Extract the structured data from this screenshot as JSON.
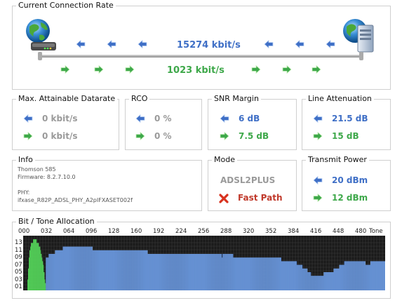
{
  "connection": {
    "title": "Current Connection Rate",
    "downstream": "15274 kbit/s",
    "upstream": "1023 kbit/s"
  },
  "max_rate": {
    "title": "Max. Attainable Datarate",
    "down": "0 kbit/s",
    "up": "0 kbit/s"
  },
  "rco": {
    "title": "RCO",
    "down": "0 %",
    "up": "0 %"
  },
  "snr": {
    "title": "SNR Margin",
    "down": "6 dB",
    "up": "7.5 dB"
  },
  "attenuation": {
    "title": "Line Attenuation",
    "down": "21.5 dB",
    "up": "15 dB"
  },
  "info": {
    "title": "Info",
    "model": "Thomson 585",
    "firmware": "Firmware: 8.2.7.10.0",
    "phy_label": "PHY:",
    "phy_value": "ifxase_R82P_ADSL_PHY_A2pIFXASET002f"
  },
  "mode": {
    "title": "Mode",
    "standard": "ADSL2PLUS",
    "path": "Fast Path"
  },
  "power": {
    "title": "Transmit Power",
    "down": "20 dBm",
    "up": "12 dBm"
  },
  "bits": {
    "title": "Bit / Tone Allocation",
    "x_ticks": [
      "000",
      "032",
      "064",
      "096",
      "128",
      "160",
      "192",
      "224",
      "256",
      "288",
      "320",
      "352",
      "384",
      "416",
      "448",
      "480",
      "Tone"
    ],
    "y_ticks": [
      "13",
      "11",
      "09",
      "07",
      "05",
      "03",
      "01"
    ]
  },
  "colors": {
    "blue": "#3f6fc6",
    "green": "#3ea84a",
    "grey": "#9a9a9a",
    "chart_bg": "#1a1a1a",
    "blue_bar": "#7fa8e0",
    "green_bar": "#67e06a"
  },
  "chart_data": {
    "type": "bar",
    "title": "Bit / Tone Allocation",
    "xlabel": "Tone",
    "ylim": [
      0,
      15
    ],
    "segments": [
      {
        "series": "upstream",
        "from": 6,
        "to": 31,
        "bits": [
          3,
          6,
          9,
          11,
          12,
          13,
          13,
          13,
          14,
          14,
          14,
          14,
          14,
          13,
          13,
          13,
          12,
          12,
          11,
          10,
          9,
          8,
          7,
          5,
          3,
          2
        ]
      },
      {
        "series": "downstream",
        "from": 32,
        "to": 511,
        "bits": [
          9,
          9,
          9,
          9,
          10,
          10,
          10,
          10,
          10,
          10,
          10,
          10,
          10,
          11,
          11,
          11,
          11,
          11,
          11,
          11,
          11,
          11,
          11,
          11,
          12,
          12,
          12,
          12,
          12,
          12,
          12,
          12,
          12,
          12,
          12,
          12,
          12,
          12,
          12,
          12,
          12,
          12,
          12,
          12,
          12,
          12,
          12,
          12,
          12,
          12,
          12,
          12,
          12,
          12,
          12,
          12,
          12,
          12,
          12,
          12,
          12,
          12,
          12,
          12,
          12,
          12,
          11,
          11,
          11,
          11,
          11,
          11,
          11,
          11,
          11,
          11,
          11,
          11,
          11,
          11,
          11,
          11,
          11,
          11,
          11,
          11,
          11,
          11,
          11,
          11,
          11,
          11,
          11,
          11,
          11,
          11,
          11,
          11,
          11,
          11,
          11,
          11,
          11,
          11,
          11,
          11,
          11,
          11,
          11,
          11,
          11,
          11,
          11,
          11,
          11,
          11,
          11,
          11,
          11,
          11,
          11,
          11,
          11,
          11,
          11,
          11,
          11,
          11,
          11,
          11,
          11,
          11,
          11,
          11,
          11,
          11,
          11,
          11,
          11,
          11,
          11,
          11,
          11,
          11,
          10,
          10,
          10,
          10,
          10,
          10,
          10,
          10,
          10,
          10,
          10,
          10,
          10,
          10,
          10,
          10,
          10,
          10,
          10,
          10,
          10,
          10,
          10,
          10,
          10,
          10,
          10,
          10,
          10,
          10,
          10,
          10,
          10,
          10,
          10,
          10,
          10,
          10,
          10,
          10,
          10,
          10,
          10,
          10,
          10,
          10,
          10,
          10,
          10,
          10,
          10,
          10,
          10,
          10,
          10,
          10,
          10,
          10,
          10,
          10,
          10,
          10,
          10,
          10,
          10,
          10,
          10,
          10,
          10,
          10,
          10,
          10,
          10,
          10,
          10,
          10,
          10,
          10,
          10,
          10,
          10,
          10,
          10,
          10,
          10,
          10,
          10,
          10,
          10,
          10,
          10,
          10,
          10,
          10,
          10,
          10,
          10,
          10,
          10,
          10,
          10,
          10,
          10,
          10,
          10,
          9,
          10,
          10,
          10,
          10,
          10,
          10,
          10,
          10,
          10,
          10,
          10,
          10,
          10,
          10,
          10,
          9,
          9,
          9,
          9,
          9,
          9,
          9,
          9,
          9,
          9,
          9,
          9,
          9,
          9,
          9,
          9,
          9,
          9,
          9,
          9,
          9,
          9,
          9,
          9,
          9,
          9,
          9,
          9,
          9,
          9,
          9,
          9,
          9,
          9,
          9,
          9,
          9,
          9,
          9,
          9,
          9,
          9,
          9,
          9,
          9,
          9,
          9,
          9,
          9,
          9,
          9,
          9,
          9,
          9,
          9,
          9,
          9,
          9,
          9,
          9,
          9,
          9,
          9,
          9,
          9,
          9,
          9,
          9,
          8,
          8,
          8,
          8,
          8,
          8,
          8,
          8,
          8,
          8,
          8,
          8,
          8,
          8,
          8,
          8,
          8,
          8,
          8,
          8,
          8,
          8,
          7,
          7,
          7,
          7,
          7,
          7,
          7,
          7,
          6,
          6,
          6,
          6,
          6,
          6,
          6,
          5,
          5,
          5,
          5,
          5,
          4,
          4,
          4,
          4,
          4,
          4,
          4,
          4,
          4,
          4,
          4,
          4,
          4,
          4,
          4,
          4,
          4,
          4,
          5,
          5,
          5,
          5,
          5,
          5,
          5,
          5,
          5,
          5,
          5,
          5,
          5,
          5,
          6,
          6,
          6,
          6,
          6,
          6,
          6,
          6,
          7,
          7,
          7,
          7,
          7,
          7,
          7,
          8,
          8,
          8,
          8,
          8,
          8,
          8,
          8,
          8,
          8,
          8,
          8,
          8,
          8,
          8,
          8,
          8,
          8,
          8,
          8,
          8,
          8,
          8,
          8,
          8,
          8,
          8,
          8,
          8,
          8,
          7,
          7,
          7,
          7,
          7,
          7,
          7,
          8,
          8,
          8,
          8,
          8,
          8,
          8,
          8,
          8,
          8,
          8,
          8,
          8,
          8,
          8,
          8,
          8,
          8,
          8,
          8,
          8
        ]
      }
    ]
  }
}
